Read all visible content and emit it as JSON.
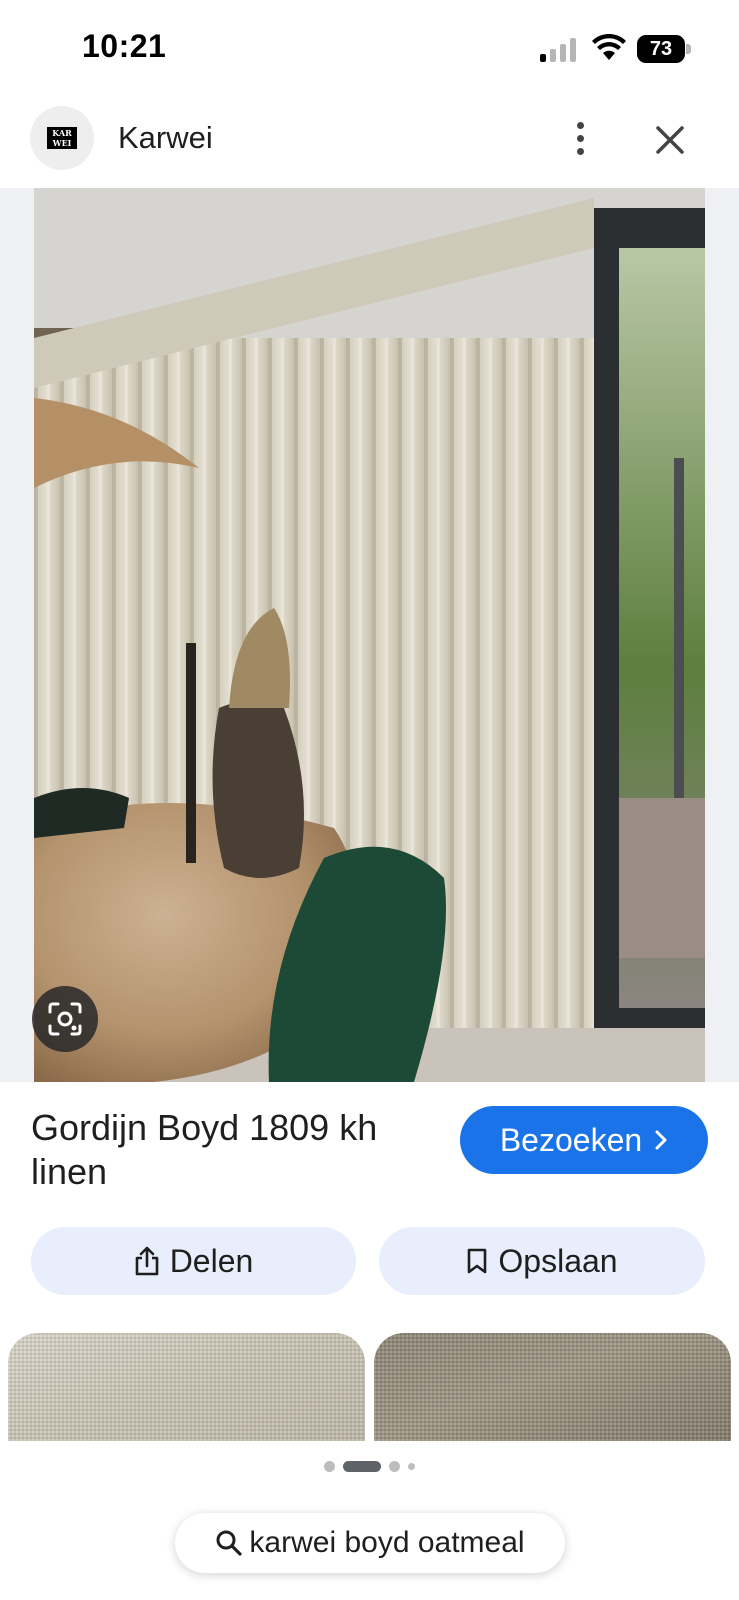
{
  "status_bar": {
    "time": "10:21",
    "battery": "73"
  },
  "source": {
    "name": "Karwei",
    "logo_text": "KAR WEI"
  },
  "product": {
    "title": "Gordijn Boyd 1809 kh linen",
    "visit_label": "Bezoeken",
    "share_label": "Delen",
    "save_label": "Opslaan"
  },
  "carousel": {
    "page_count": 4,
    "active_page": 2
  },
  "search": {
    "query": "karwei boyd oatmeal"
  },
  "colors": {
    "accent": "#1a73e8",
    "chip_background": "#e8eefb"
  },
  "icons": [
    "more-vert-icon",
    "close-icon",
    "lens-icon",
    "share-icon",
    "bookmark-icon",
    "search-icon",
    "chevron-right-icon"
  ]
}
